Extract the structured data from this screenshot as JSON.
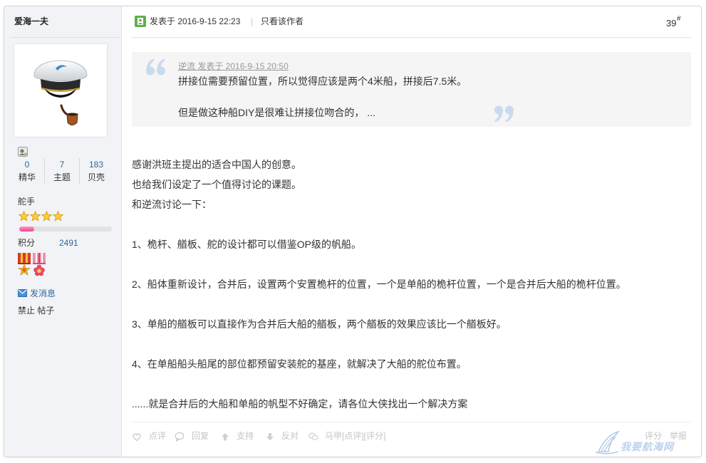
{
  "colors": {
    "sidebar_bg": "#f1f3f6",
    "link_blue": "#336699",
    "quote_mark": "#c9daee",
    "progress_fill": "#e8458f",
    "muted_text": "#c4c4c4",
    "post_icon_green": "#5fb04a"
  },
  "author": {
    "name": "爱海一夫",
    "avatar_icon": "captain-hat-pipe-avatar",
    "status_icon": "user-status-icon",
    "stats": [
      {
        "value": "0",
        "label": "精华"
      },
      {
        "value": "7",
        "label": "主题"
      },
      {
        "value": "183",
        "label": "贝壳"
      }
    ],
    "rank": "舵手",
    "stars": 4,
    "level_progress": 0.16,
    "points": {
      "label": "积分",
      "value": "2491"
    },
    "medals": [
      "medal-icon",
      "medal-icon"
    ],
    "send_message": "发消息",
    "ban_label": "禁止",
    "posts_label": "帖子"
  },
  "post": {
    "posted_at": "发表于 2016-9-15 22:23",
    "separator": "|",
    "only_author": "只看该作者",
    "floor": "39",
    "floor_mark": "#",
    "quote": {
      "author_line": "逆流 发表于 2016-9-15 20:50",
      "lines": [
        "拼接位需要预留位置，所以觉得应该是两个4米船，拼接后7.5米。",
        "但是做这种船DIY是很难让拼接位吻合的， ..."
      ]
    },
    "body": [
      "感谢洪班主提出的适合中国人的创意。",
      "也给我们设定了一个值得讨论的课题。",
      "和逆流讨论一下：",
      "1、桅杆、艏板、舵的设计都可以借鉴OP级的帆船。",
      "2、船体重新设计，合并后，设置两个安置桅杆的位置，一个是单船的桅杆位置，一个是合并后大船的桅杆位置。",
      "3、单船的艏板可以直接作为合并后大船的艏板，两个艏板的效果应该比一个艏板好。",
      "4、在单船船头船尾的部位都预留安装舵的基座，就解决了大船的舵位布置。",
      "......就是合并后的大船和单船的帆型不好确定，请各位大侠找出一个解决方案"
    ]
  },
  "actions": {
    "left": [
      {
        "icon": "comment-heart-icon",
        "label": "点评"
      },
      {
        "icon": "reply-bubble-icon",
        "label": "回复"
      },
      {
        "icon": "support-up-arrow-icon",
        "label": "支持"
      },
      {
        "icon": "oppose-down-arrow-icon",
        "label": "反对"
      },
      {
        "icon": "vest-bubbles-icon",
        "label": "马甲[点评][评分]"
      }
    ],
    "right": [
      "评分",
      "举报"
    ]
  },
  "watermark": "我要航海网"
}
